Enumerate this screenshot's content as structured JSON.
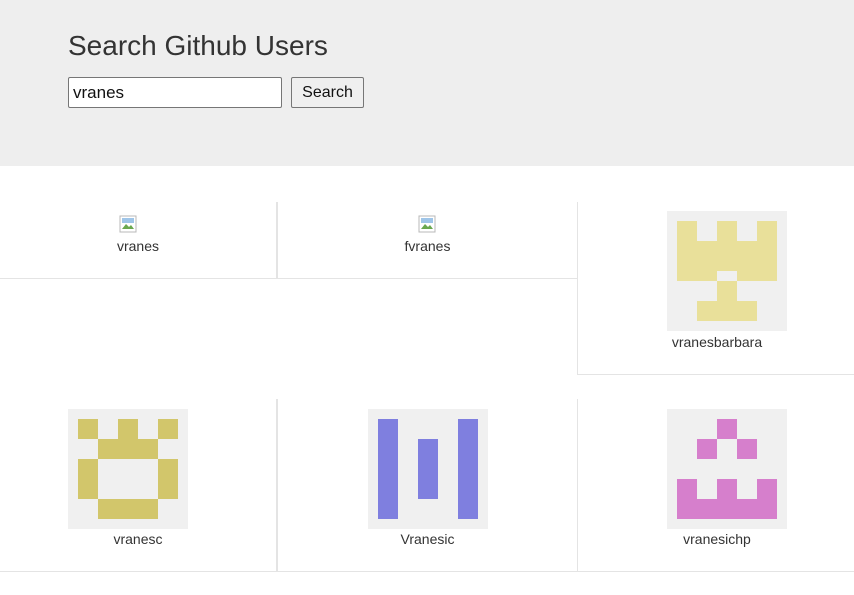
{
  "header": {
    "title": "Search Github Users",
    "search_value": "vranes",
    "search_button": "Search"
  },
  "results": [
    {
      "login": "vranes",
      "avatar": "broken-image-icon"
    },
    {
      "login": "fvranes",
      "avatar": "broken-image-icon"
    },
    {
      "login": "vranesbarbara",
      "avatar": "identicon",
      "color": "#e9e09a"
    },
    {
      "login": "vranesc",
      "avatar": "identicon",
      "color": "#d2c66b"
    },
    {
      "login": "Vranesic",
      "avatar": "identicon",
      "color": "#7f7fdf"
    },
    {
      "login": "vranesichp",
      "avatar": "identicon",
      "color": "#d67fcc"
    }
  ],
  "colors": {
    "header_bg": "#eeeeee",
    "card_border": "#e4e4e4",
    "avatar_bg": "#f0f0f0"
  }
}
